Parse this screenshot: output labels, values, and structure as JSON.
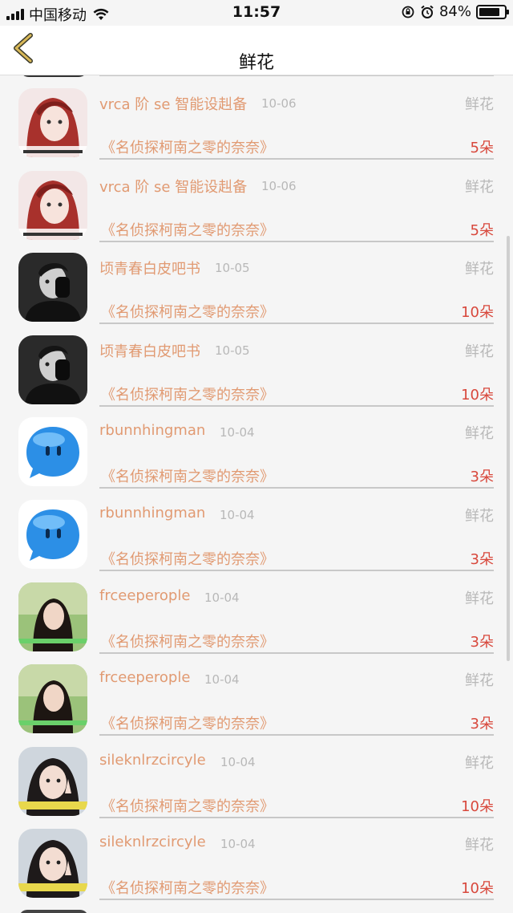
{
  "status_bar": {
    "carrier": "中国移动",
    "time": "11:57",
    "battery_percent": "84%",
    "battery_level": 0.84
  },
  "nav": {
    "title": "鲜花",
    "back_icon": "chevron-left-icon"
  },
  "records": [
    {
      "user": "vrca 阶 se 智能设赳备",
      "date": "10-06",
      "type": "鲜花",
      "book": "《名侦探柯南之零的奈奈》",
      "count": "5朵",
      "avatar": "girl-red-hair"
    },
    {
      "user": "vrca 阶 se 智能设赳备",
      "date": "10-06",
      "type": "鲜花",
      "book": "《名侦探柯南之零的奈奈》",
      "count": "5朵",
      "avatar": "girl-red-hair"
    },
    {
      "user": "顷青春白皮吧书",
      "date": "10-05",
      "type": "鲜花",
      "book": "《名侦探柯南之零的奈奈》",
      "count": "10朵",
      "avatar": "man-bw"
    },
    {
      "user": "顷青春白皮吧书",
      "date": "10-05",
      "type": "鲜花",
      "book": "《名侦探柯南之零的奈奈》",
      "count": "10朵",
      "avatar": "man-bw"
    },
    {
      "user": "rbunnhingman",
      "date": "10-04",
      "type": "鲜花",
      "book": "《名侦探柯南之零的奈奈》",
      "count": "3朵",
      "avatar": "blue-bubble"
    },
    {
      "user": "rbunnhingman",
      "date": "10-04",
      "type": "鲜花",
      "book": "《名侦探柯南之零的奈奈》",
      "count": "3朵",
      "avatar": "blue-bubble"
    },
    {
      "user": "frceeperople",
      "date": "10-04",
      "type": "鲜花",
      "book": "《名侦探柯南之零的奈奈》",
      "count": "3朵",
      "avatar": "girl-green"
    },
    {
      "user": "frceeperople",
      "date": "10-04",
      "type": "鲜花",
      "book": "《名侦探柯南之零的奈奈》",
      "count": "3朵",
      "avatar": "girl-green"
    },
    {
      "user": "sileknlrzcircyle",
      "date": "10-04",
      "type": "鲜花",
      "book": "《名侦探柯南之零的奈奈》",
      "count": "10朵",
      "avatar": "girl-peace"
    },
    {
      "user": "sileknlrzcircyle",
      "date": "10-04",
      "type": "鲜花",
      "book": "《名侦探柯南之零的奈奈》",
      "count": "10朵",
      "avatar": "girl-peace"
    }
  ],
  "colors": {
    "name": "#e19a72",
    "count": "#d8483c",
    "muted": "#b8b8b8",
    "back_icon": "#c9a648"
  }
}
